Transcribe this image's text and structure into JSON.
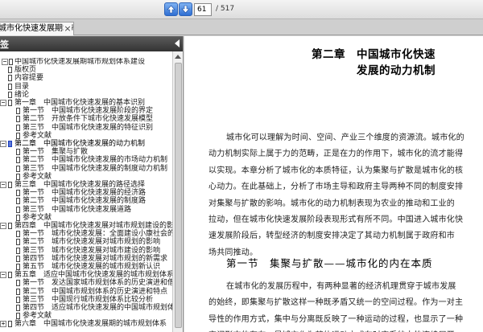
{
  "toolbar": {
    "prev_page_icon": "arrow-up-icon",
    "next_page_icon": "arrow-down-icon",
    "page_current": "61",
    "page_total": "/ 517"
  },
  "tab": {
    "title": "城市化快速发展期城市...",
    "close": "×"
  },
  "bookmarks": {
    "title": "签",
    "items": [
      {
        "expander": "−",
        "level": 0,
        "text": "中国城市化快速发展期城市规划体系建设"
      },
      {
        "expander": "",
        "level": 1,
        "text": "版权页"
      },
      {
        "expander": "",
        "level": 1,
        "text": "内容提要"
      },
      {
        "expander": "",
        "level": 1,
        "text": "目录"
      },
      {
        "expander": "",
        "level": 1,
        "text": "绪论"
      },
      {
        "expander": "−",
        "level": 1,
        "text": "第一章　中国城市化快速发展的基本识别"
      },
      {
        "expander": "",
        "level": 2,
        "text": "第一节　中国城市化快速发展阶段的界定"
      },
      {
        "expander": "",
        "level": 2,
        "text": "第二节　开放条件下城市化快速发展模型"
      },
      {
        "expander": "",
        "level": 2,
        "text": "第三节　中国城市化快速发展的特征识别"
      },
      {
        "expander": "",
        "level": 2,
        "text": "参考文献"
      },
      {
        "expander": "−",
        "level": 1,
        "text": "第二章　中国城市化快速发展的动力机制",
        "highlight": true
      },
      {
        "expander": "",
        "level": 2,
        "text": "第一节　集聚与扩散"
      },
      {
        "expander": "",
        "level": 2,
        "text": "第二节　中国城市化快速发展的市场动力机制"
      },
      {
        "expander": "",
        "level": 2,
        "text": "第三节　中国城市化快速发展的制度动力机制"
      },
      {
        "expander": "",
        "level": 2,
        "text": "参考文献"
      },
      {
        "expander": "−",
        "level": 1,
        "text": "第三章　中国城市化快速发展的路径选择"
      },
      {
        "expander": "",
        "level": 2,
        "text": "第一节　中国城市化快速发展的经济路"
      },
      {
        "expander": "",
        "level": 2,
        "text": "第二节　中国城市化快速发展的制度路"
      },
      {
        "expander": "",
        "level": 2,
        "text": "第三节　中国城市化快速发展道路"
      },
      {
        "expander": "",
        "level": 2,
        "text": "参考文献"
      },
      {
        "expander": "−",
        "level": 1,
        "text": "第四章　中国城市化快速发展对城市规划建设的影"
      },
      {
        "expander": "",
        "level": 2,
        "text": "第一节　城市化快速发展：全面建设小康社会的"
      },
      {
        "expander": "",
        "level": 2,
        "text": "第二节　城市化快速发展对城市规划的影响"
      },
      {
        "expander": "",
        "level": 2,
        "text": "第三节　城市化快速发展对城市建设的影响"
      },
      {
        "expander": "",
        "level": 2,
        "text": "第四节　城市化快速发展对城市规划的新需求"
      },
      {
        "expander": "",
        "level": 2,
        "text": "第五节　城市化快速发展的城市规划新认识"
      },
      {
        "expander": "−",
        "level": 1,
        "text": "第五章　适应中国城市化快速发展的城市规划体系"
      },
      {
        "expander": "",
        "level": 2,
        "text": "第一节　发达国家城市规划体系的历史演进和借"
      },
      {
        "expander": "",
        "level": 2,
        "text": "第二节　中国城市规划体系的历史演进和特点"
      },
      {
        "expander": "",
        "level": 2,
        "text": "第三节　中国现行城市规划体系比较分析"
      },
      {
        "expander": "",
        "level": 2,
        "text": "第四节　适应城市化快速发展的中国城市规划体"
      },
      {
        "expander": "",
        "level": 2,
        "text": "参考文献"
      },
      {
        "expander": "+",
        "level": 1,
        "text": "第六章　中国城市化快速发展期的城市规划体系"
      }
    ]
  },
  "document": {
    "chapter_title_line1": "第二章　中国城市化快速",
    "chapter_title_line2": "发展的动力机制",
    "paragraph1": [
      "城市化可以理解为时间、空间、产业三个维度的资源流。城市化的",
      "动力机制实际上属于力的范畴，正是在力的作用下，城市化的流才能得",
      "以实现。本章分析了城市化的本质特征，认为集聚与扩散是城市化的核",
      "心动力。在此基础上，分析了市场主导和政府主导两种不同的制度安排",
      "对集聚与扩散的影响。城市化的动力机制表现为农业的推动和工业的",
      "拉动，但在城市化快速发展阶段表现形式有所不同。中国进入城市化快",
      "速发展阶段后，转型经济的制度安排决定了其动力机制属于政府和市",
      "场共同推动。"
    ],
    "section_title": "第一节　集聚与扩散——城市化的内在本质",
    "paragraph2": [
      "在城市化的发展历程中，有两种显著的经济机理贯穿于城市发展",
      "的始终，即集聚与扩散这样一种既矛盾又统一的空间过程。作为一对主",
      "导性的作用方式，集中与分离既反映了一种运动的过程，也显示了一种",
      "空间形态的存在，是城市作为整体运动方式在时空系统中的连续展开。"
    ]
  }
}
